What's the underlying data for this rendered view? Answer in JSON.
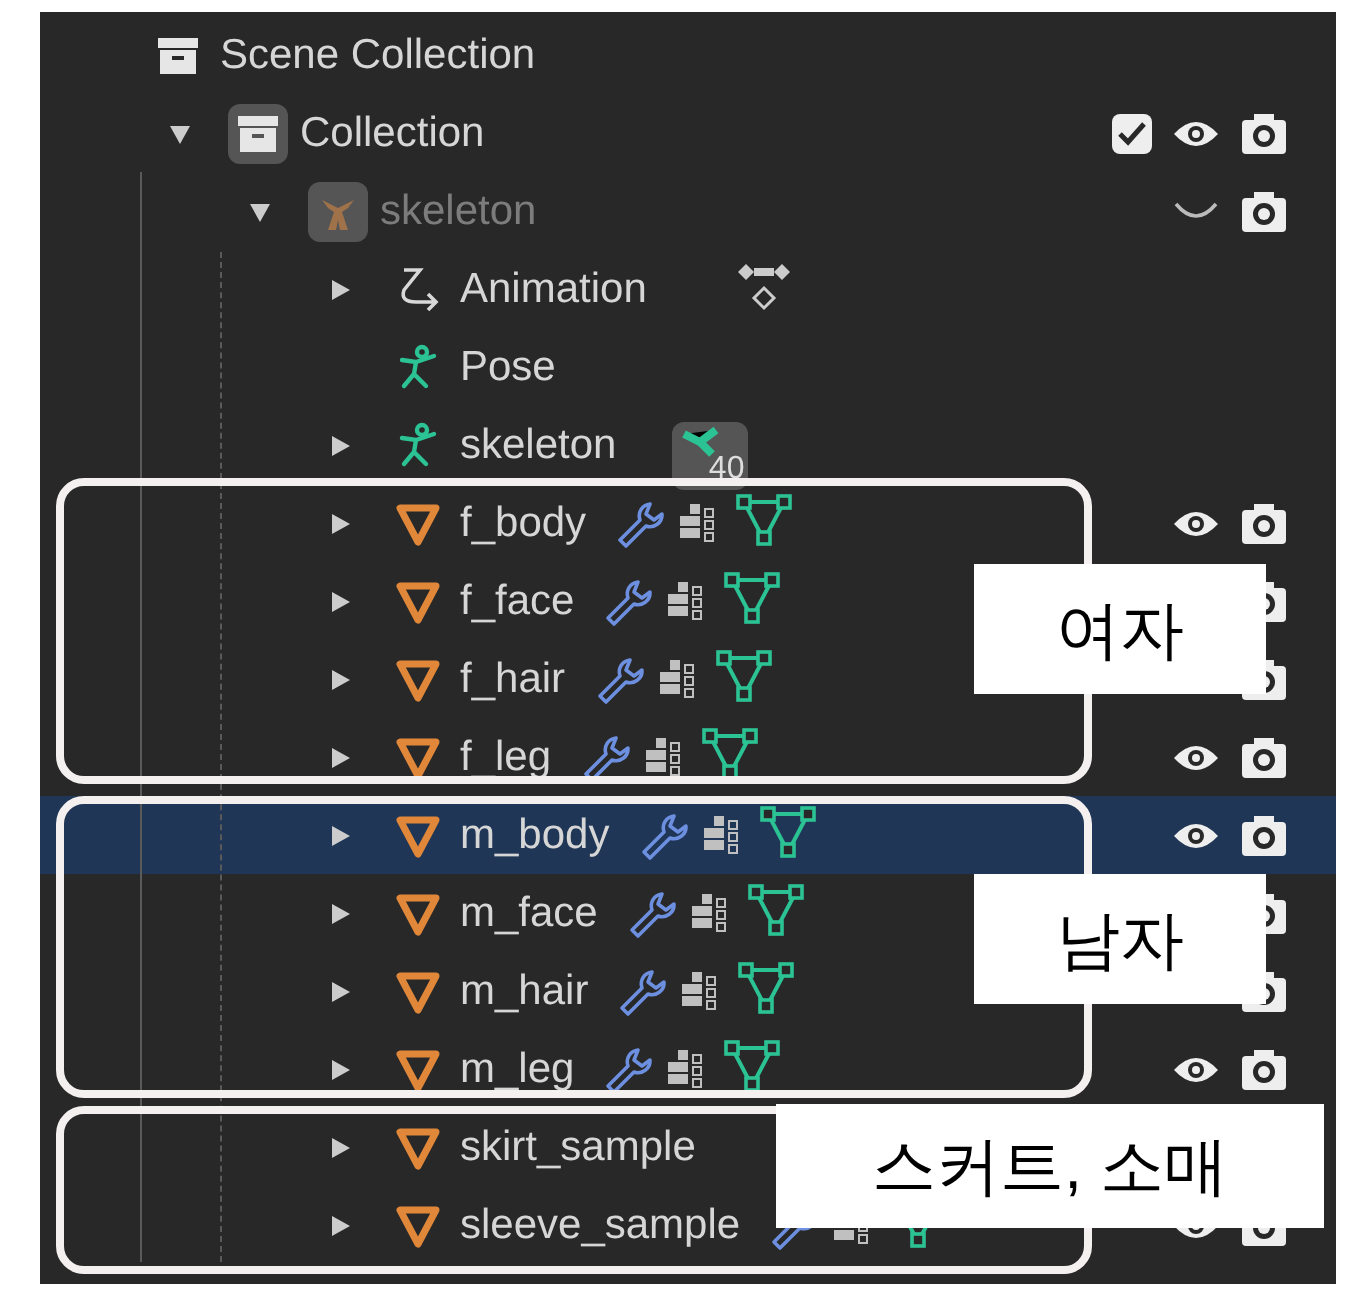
{
  "outliner": {
    "items": [
      {
        "kind": "scene_collection",
        "label": "Scene Collection",
        "children": [
          {
            "kind": "collection",
            "label": "Collection",
            "expanded": true,
            "checked": true,
            "visible": true,
            "camera": true,
            "children": [
              {
                "kind": "armature",
                "label": "skeleton",
                "expanded": true,
                "dimmed": true,
                "visible": false,
                "camera": true,
                "children": [
                  {
                    "kind": "action",
                    "label": "Animation",
                    "expanded": false
                  },
                  {
                    "kind": "pose",
                    "label": "Pose"
                  },
                  {
                    "kind": "armature_data",
                    "label": "skeleton",
                    "expanded": false,
                    "badge": "40"
                  },
                  {
                    "kind": "mesh",
                    "label": "f_body",
                    "expanded": false,
                    "selected": false,
                    "visible": true,
                    "camera": true
                  },
                  {
                    "kind": "mesh",
                    "label": "f_face",
                    "expanded": false,
                    "selected": false,
                    "camera": true
                  },
                  {
                    "kind": "mesh",
                    "label": "f_hair",
                    "expanded": false,
                    "selected": false,
                    "camera": true
                  },
                  {
                    "kind": "mesh",
                    "label": "f_leg",
                    "expanded": false,
                    "selected": false,
                    "visible": true,
                    "camera": true
                  },
                  {
                    "kind": "mesh",
                    "label": "m_body",
                    "expanded": false,
                    "selected": true,
                    "visible": true,
                    "camera": true
                  },
                  {
                    "kind": "mesh",
                    "label": "m_face",
                    "expanded": false,
                    "selected": false,
                    "camera": true
                  },
                  {
                    "kind": "mesh",
                    "label": "m_hair",
                    "expanded": false,
                    "selected": false,
                    "camera": true
                  },
                  {
                    "kind": "mesh",
                    "label": "m_leg",
                    "expanded": false,
                    "selected": false,
                    "visible": true,
                    "camera": true
                  },
                  {
                    "kind": "mesh",
                    "label": "skirt_sample",
                    "expanded": false,
                    "selected": false
                  },
                  {
                    "kind": "mesh",
                    "label": "sleeve_sample",
                    "expanded": false,
                    "selected": false,
                    "visible": true,
                    "camera": true
                  }
                ]
              }
            ]
          }
        ]
      }
    ]
  },
  "annotations": [
    {
      "label": "여자"
    },
    {
      "label": "남자"
    },
    {
      "label": "스커트, 소매"
    }
  ]
}
